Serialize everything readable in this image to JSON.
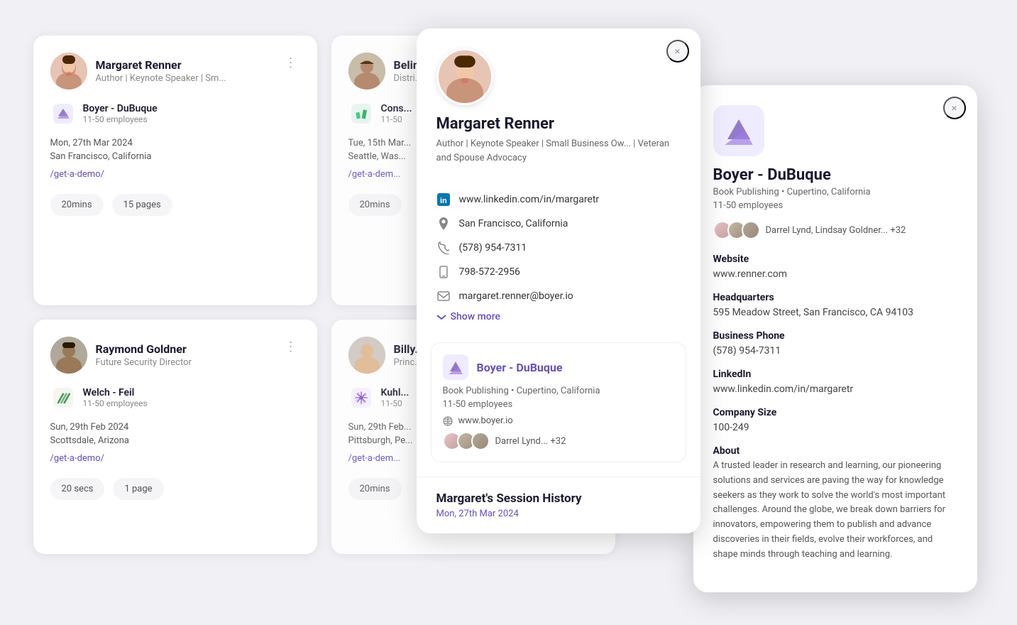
{
  "cards": [
    {
      "id": "margaret-renner",
      "name": "Margaret Renner",
      "title": "Author | Keynote Speaker | Sm...",
      "company_name": "Boyer - DuBuque",
      "company_size": "11-50 employees",
      "date": "Mon, 27th Mar 2024",
      "location": "San Francisco, California",
      "link": "/get-a-demo/",
      "duration": "20mins",
      "pages": "15 pages",
      "avatar_class": "face-margaret"
    },
    {
      "id": "belinda",
      "name": "Belin...",
      "title": "Distri...",
      "company_name": "Cons...",
      "company_size": "11-50",
      "date": "Tue, 15th Mar...",
      "location": "Seattle, Was...",
      "link": "/get-a-dem...",
      "duration": "20mins",
      "pages": "",
      "avatar_class": "face-belinda"
    },
    {
      "id": "raymond-goldner",
      "name": "Raymond Goldner",
      "title": "Future Security Director",
      "company_name": "Welch - Feil",
      "company_size": "11-50 employees",
      "date": "Sun, 29th Feb 2024",
      "location": "Scottsdale, Arizona",
      "link": "/get-a-demo/",
      "duration": "20 secs",
      "pages": "1 page",
      "avatar_class": "face-raymond"
    },
    {
      "id": "billy",
      "name": "Billy...",
      "title": "Princ...",
      "company_name": "Kuhl...",
      "company_size": "11-50",
      "date": "Sun, 29th Feb...",
      "location": "Pittsburgh, Pe...",
      "link": "/get-a-dem...",
      "duration": "20mins",
      "pages": "",
      "avatar_class": "face-billy"
    }
  ],
  "profile_modal": {
    "name": "Margaret Renner",
    "title": "Author | Keynote Speaker | Small Business Ow... | Veteran and Spouse Advocacy",
    "linkedin": "www.linkedin.com/in/margaretr",
    "location": "San Francisco, California",
    "phone": "(578) 954-7311",
    "mobile": "798-572-2956",
    "email": "margaret.renner@boyer.io",
    "show_more": "Show more",
    "company_card": {
      "name": "Boyer - DuBuque",
      "sub": "Book Publishing • Cupertino, California",
      "employees": "11-50 employees",
      "website": "www.boyer.io",
      "contacts": "Darrel Lynd... +32"
    },
    "session_history_label": "Margaret's Session History",
    "session_date": "Mon, 27th Mar 2024"
  },
  "company_panel": {
    "name": "Boyer - DuBuque",
    "sub": "Book Publishing • Cupertino, California",
    "employees": "11-50 employees",
    "contacts": "Darrel Lynd, Lindsay Goldner... +32",
    "website_label": "Website",
    "website": "www.renner.com",
    "headquarters_label": "Headquarters",
    "headquarters": "595 Meadow Street,\nSan Francisco, CA 94103",
    "business_phone_label": "Business Phone",
    "business_phone": "(578) 954-7311",
    "linkedin_label": "LinkedIn",
    "linkedin": "www.linkedin.com/in/margaretr",
    "company_size_label": "Company Size",
    "company_size": "100-249",
    "about_label": "About",
    "about": "A trusted leader in research and learning, our pioneering solutions and services are paving the way for knowledge seekers as they work to solve the world's most important challenges. Around the globe, we break down barriers for innovators, empowering them to publish and advance discoveries in their fields, evolve their workforces, and shape minds through teaching and learning."
  },
  "icons": {
    "close": "×",
    "more": "⋮",
    "chevron_down": "⌄",
    "linkedin": "in",
    "location_pin": "◎",
    "phone": "✆",
    "mobile": "📱",
    "email": "✉",
    "link": "🔗"
  }
}
